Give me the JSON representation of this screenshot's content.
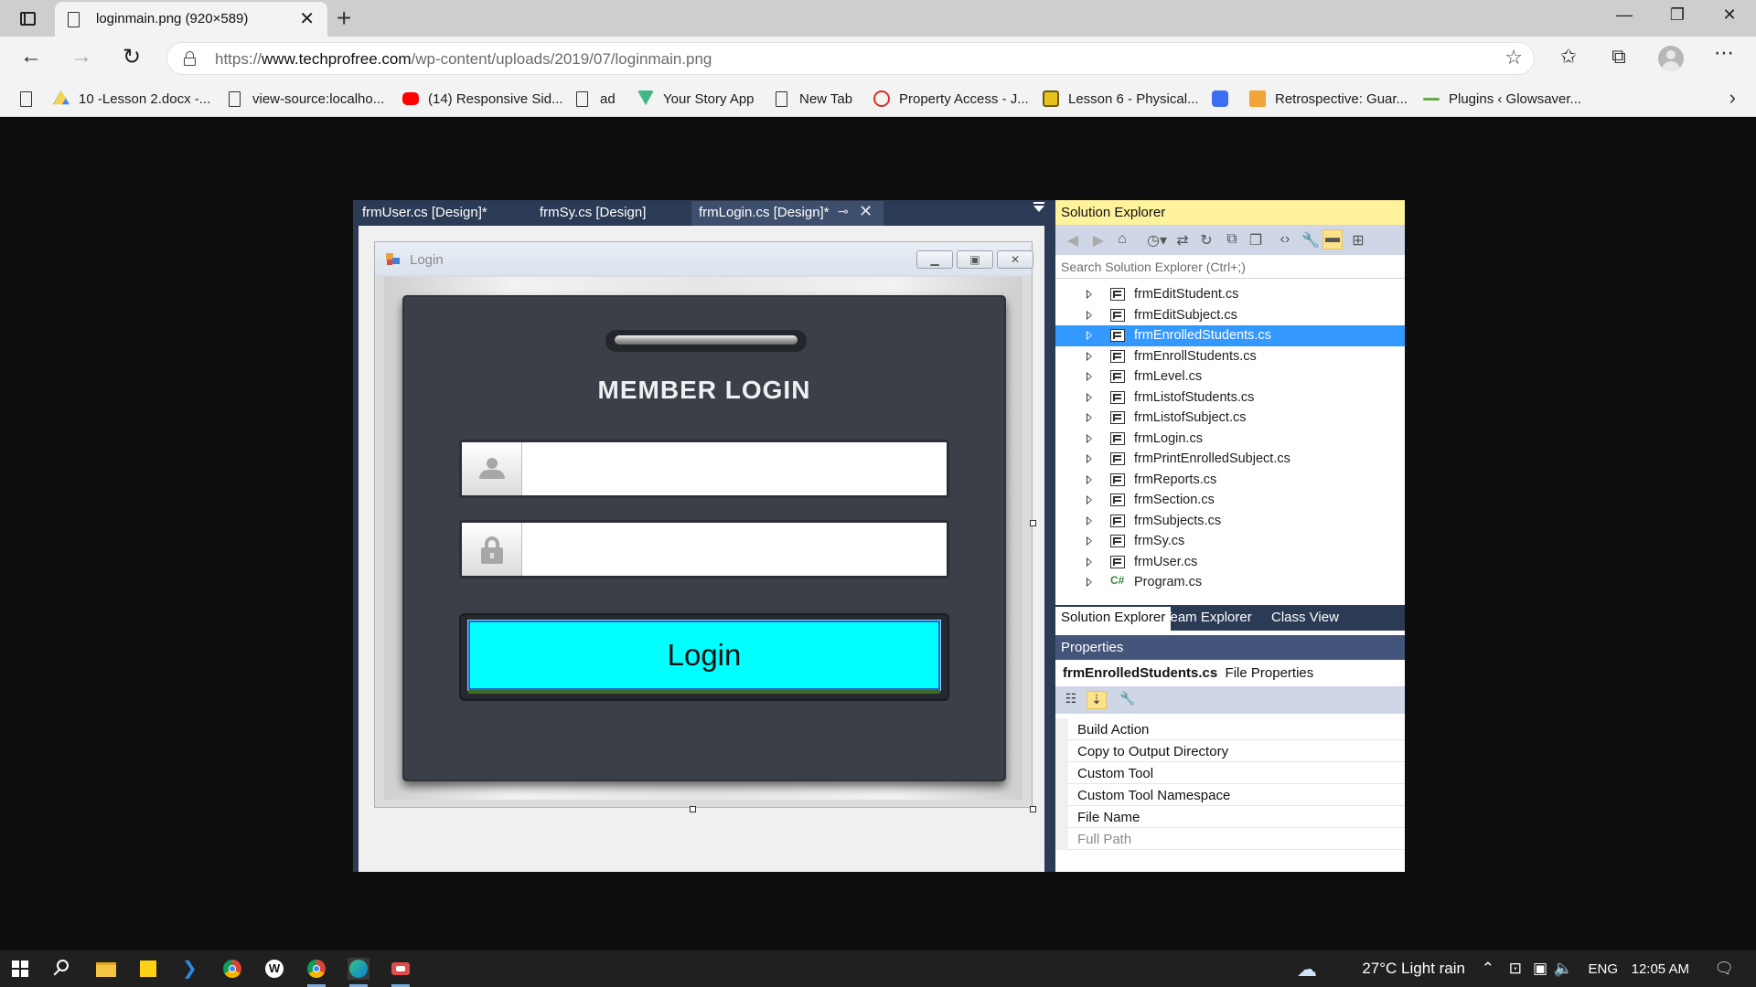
{
  "browser": {
    "tab_title": "loginmain.png (920×589)",
    "url_prefix": "https://",
    "url_host": "www.techprofree.com",
    "url_path": "/wp-content/uploads/2019/07/loginmain.png",
    "bookmarks": [
      {
        "label": "10 -Lesson 2.docx -...",
        "icon": "google-drive-icon"
      },
      {
        "label": "view-source:localho...",
        "icon": "document-icon"
      },
      {
        "label": "(14) Responsive Sid...",
        "icon": "youtube-icon"
      },
      {
        "label": "ad",
        "icon": "document-icon"
      },
      {
        "label": "Your Story App",
        "icon": "vue-icon"
      },
      {
        "label": "New Tab",
        "icon": "document-icon"
      },
      {
        "label": "Property Access - J...",
        "icon": "codecademy-icon"
      },
      {
        "label": "Lesson 6 - Physical...",
        "icon": "site-icon"
      },
      {
        "label": "",
        "icon": "site-icon"
      },
      {
        "label": "Retrospective: Guar...",
        "icon": "site-icon"
      },
      {
        "label": "Plugins ‹ Glowsaver...",
        "icon": "site-icon"
      }
    ]
  },
  "vs": {
    "designer_tabs": [
      "frmUser.cs [Design]*",
      "frmSy.cs [Design]",
      "frmLogin.cs [Design]*"
    ],
    "form": {
      "title": "Login",
      "heading": "MEMBER LOGIN",
      "username_value": "",
      "password_value": "",
      "login_button": "Login"
    },
    "solution_explorer": {
      "title": "Solution Explorer",
      "search_placeholder": "Search Solution Explorer (Ctrl+;)",
      "files": [
        "frmEditStudent.cs",
        "frmEditSubject.cs",
        "frmEnrolledStudents.cs",
        "frmEnrollStudents.cs",
        "frmLevel.cs",
        "frmListofStudents.cs",
        "frmListofSubject.cs",
        "frmLogin.cs",
        "frmPrintEnrolledSubject.cs",
        "frmReports.cs",
        "frmSection.cs",
        "frmSubjects.cs",
        "frmSy.cs",
        "frmUser.cs",
        "Program.cs"
      ],
      "selected_file": "frmEnrolledStudents.cs",
      "tabs": [
        "Solution Explorer",
        "Team Explorer",
        "Class View"
      ]
    },
    "properties": {
      "title": "Properties",
      "subject_name": "frmEnrolledStudents.cs",
      "subject_type": "File Properties",
      "rows": [
        "Build Action",
        "Copy to Output Directory",
        "Custom Tool",
        "Custom Tool Namespace",
        "File Name",
        "Full Path"
      ]
    }
  },
  "taskbar": {
    "weather": "27°C  Light rain",
    "language": "ENG",
    "time": "12:05 AM"
  },
  "colors": {
    "login_button": "#00ffff",
    "selection": "#3399ff",
    "vs_chrome": "#2b3a55",
    "solution_title": "#fff29d"
  }
}
